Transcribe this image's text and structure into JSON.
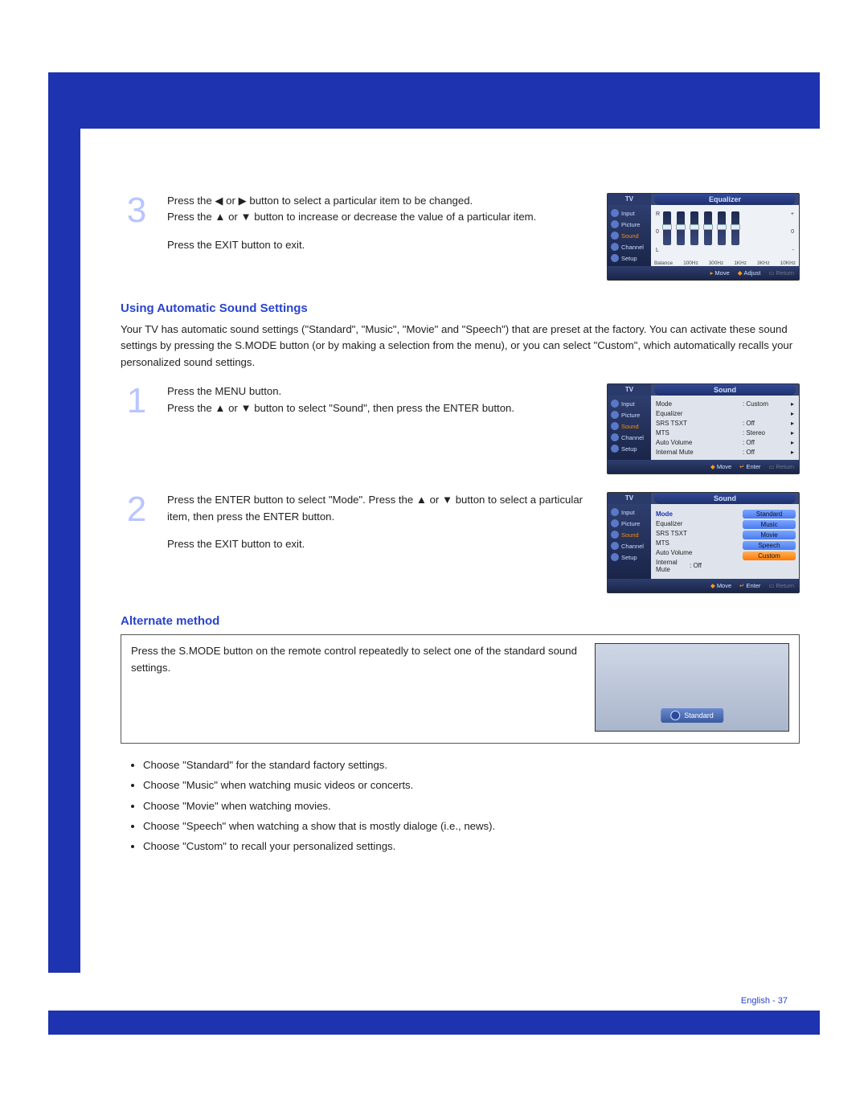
{
  "step3": {
    "number": "3",
    "text1": "Press the ◀ or ▶ button to select a particular item to be changed.\nPress the ▲ or ▼ button to increase or decrease the value of a particular item.",
    "text2": "Press the EXIT button to exit."
  },
  "osd_eq": {
    "tv": "TV",
    "title": "Equalizer",
    "side": [
      "Input",
      "Picture",
      "Sound",
      "Channel",
      "Setup"
    ],
    "legend": [
      "R",
      "0",
      "L",
      "+",
      "0",
      "-"
    ],
    "bands": [
      "Balance",
      "100Hz",
      "300Hz",
      "1KHz",
      "3KHz",
      "10KHz"
    ],
    "foot": [
      "Move",
      "Adjust",
      "Return"
    ]
  },
  "section_auto": {
    "heading": "Using Automatic Sound Settings",
    "intro": "Your TV has automatic sound settings (\"Standard\", \"Music\", \"Movie\" and \"Speech\") that are preset at the factory. You can activate these sound settings by pressing the S.MODE button (or by making a selection from the menu), or you can select \"Custom\", which automatically recalls your personalized sound settings."
  },
  "step1": {
    "number": "1",
    "text": "Press the MENU button.\nPress the ▲ or ▼ button to select \"Sound\", then press the ENTER button."
  },
  "osd_sound1": {
    "tv": "TV",
    "title": "Sound",
    "side": [
      "Input",
      "Picture",
      "Sound",
      "Channel",
      "Setup"
    ],
    "rows": [
      {
        "l": "Mode",
        "v": ": Custom"
      },
      {
        "l": "Equalizer",
        "v": ""
      },
      {
        "l": "SRS TSXT",
        "v": ": Off"
      },
      {
        "l": "MTS",
        "v": ": Stereo"
      },
      {
        "l": "Auto Volume",
        "v": ": Off"
      },
      {
        "l": "Internal Mute",
        "v": ": Off"
      }
    ],
    "foot": [
      "Move",
      "Enter",
      "Return"
    ]
  },
  "step2": {
    "number": "2",
    "text1": "Press the ENTER button to select \"Mode\". Press the ▲ or ▼ button to select a particular item, then press the ENTER button.",
    "text2": "Press the EXIT button to exit."
  },
  "osd_sound2": {
    "tv": "TV",
    "title": "Sound",
    "side": [
      "Input",
      "Picture",
      "Sound",
      "Channel",
      "Setup"
    ],
    "rows": [
      {
        "l": "Mode"
      },
      {
        "l": "Equalizer"
      },
      {
        "l": "SRS TSXT"
      },
      {
        "l": "MTS"
      },
      {
        "l": "Auto Volume"
      },
      {
        "l": "Internal Mute",
        "v": ": Off"
      }
    ],
    "options": [
      "Standard",
      "Music",
      "Movie",
      "Speech",
      "Custom"
    ],
    "foot": [
      "Move",
      "Enter",
      "Return"
    ]
  },
  "alt": {
    "heading": "Alternate method",
    "text": "Press the S.MODE button on the remote control repeatedly to select one of the standard sound settings.",
    "toast": "Standard"
  },
  "bullets": [
    "Choose \"Standard\" for the standard factory settings.",
    "Choose \"Music\" when watching music videos or concerts.",
    "Choose \"Movie\" when watching movies.",
    "Choose \"Speech\" when watching a show that is mostly dialoge (i.e., news).",
    "Choose \"Custom\" to recall your personalized settings."
  ],
  "footer": "English - 37"
}
